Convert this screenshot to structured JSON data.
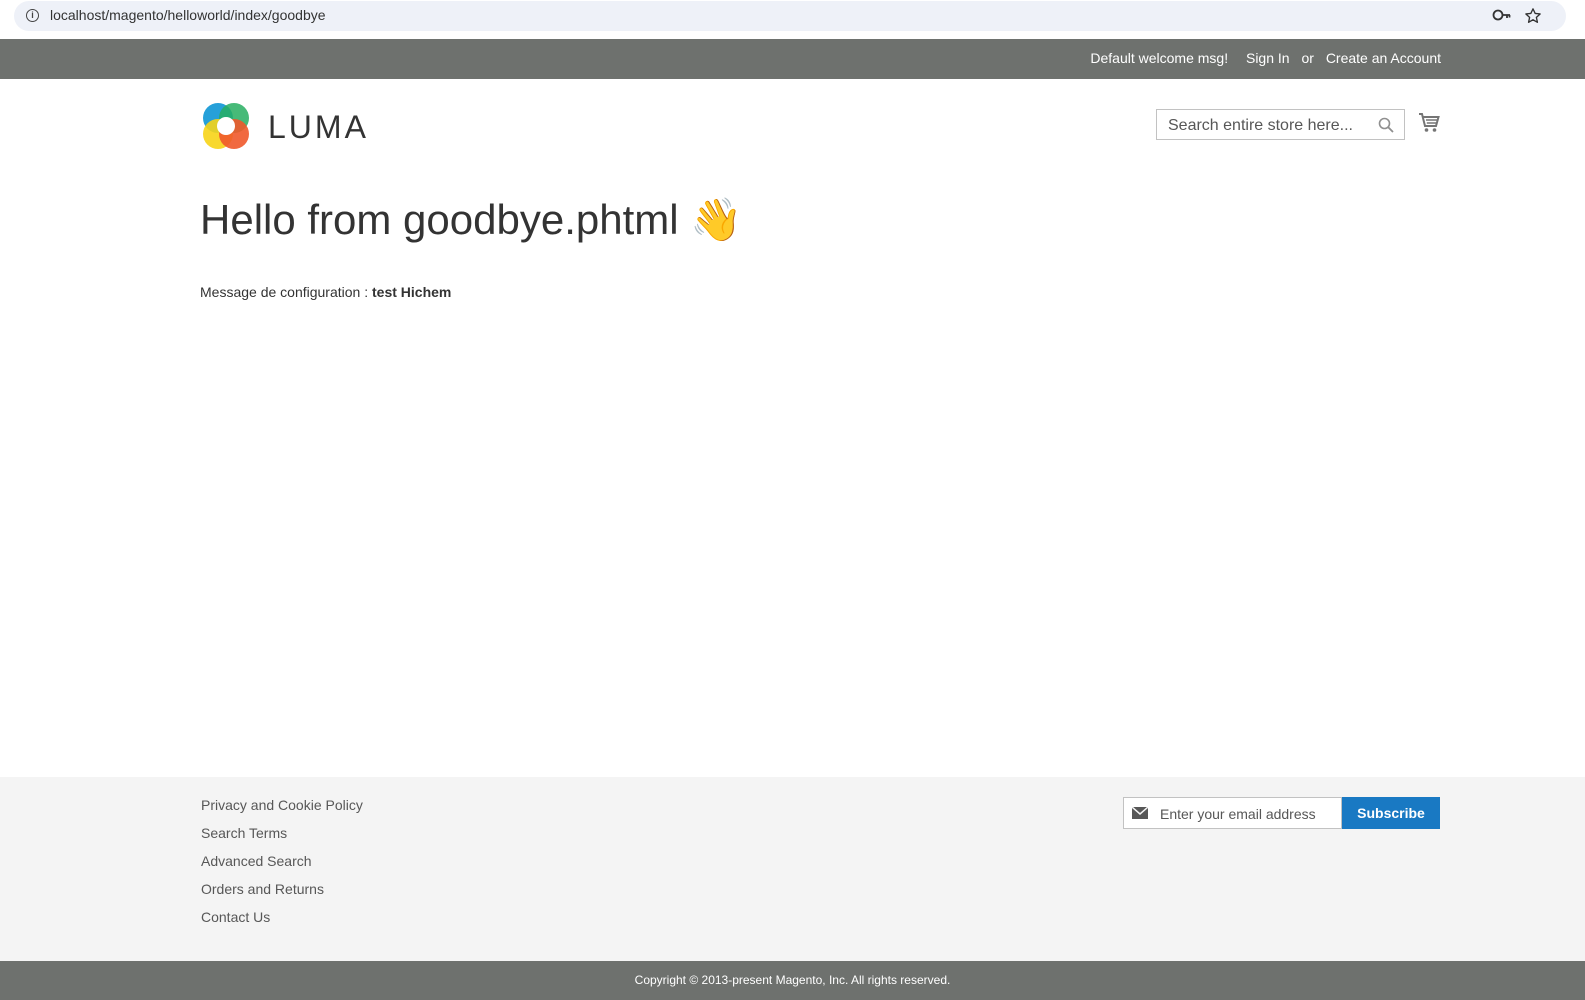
{
  "browser": {
    "url": "localhost/magento/helloworld/index/goodbye",
    "icons": [
      "info-icon",
      "key-icon",
      "star-icon"
    ]
  },
  "header": {
    "welcome": "Default welcome msg!",
    "sign_in": "Sign In",
    "or": "or",
    "create_account": "Create an Account"
  },
  "logo": {
    "text": "LUMA"
  },
  "search": {
    "placeholder": "Search entire store here..."
  },
  "main": {
    "title": "Hello from goodbye.phtml 👋",
    "config_label": "Message de configuration : ",
    "config_value": "test Hichem"
  },
  "footer": {
    "links": [
      "Privacy and Cookie Policy",
      "Search Terms",
      "Advanced Search",
      "Orders and Returns",
      "Contact Us"
    ],
    "email_placeholder": "Enter your email address",
    "subscribe_label": "Subscribe",
    "copyright": "Copyright © 2013-present Magento, Inc. All rights reserved."
  },
  "colors": {
    "header_bg": "#6e716e",
    "footer_bg": "#f4f4f4",
    "subscribe_bg": "#1979c3"
  }
}
